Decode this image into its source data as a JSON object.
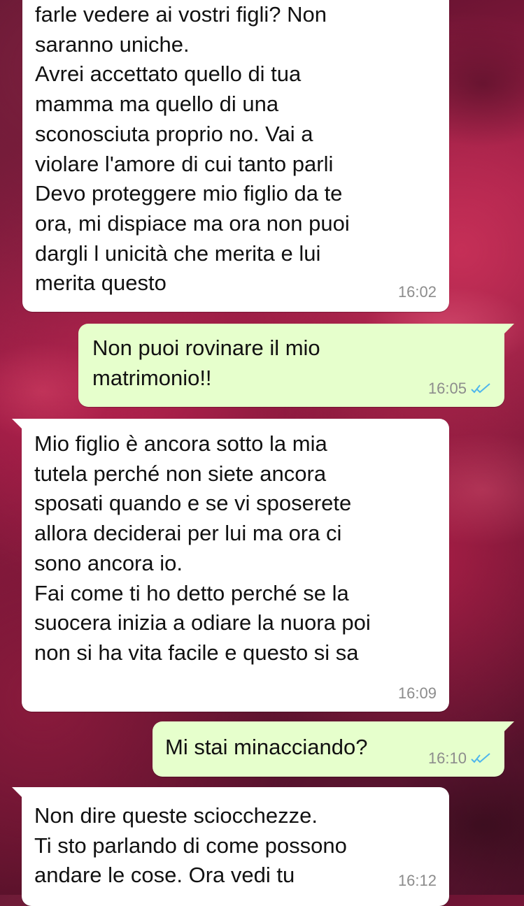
{
  "chat": {
    "messages": [
      {
        "direction": "in",
        "text": "farle vedere ai vostri figli? Non\nsaranno uniche.\nAvrei accettato quello di tua\nmamma ma quello di una\nsconosciuta proprio no. Vai a\nviolare l'amore di cui tanto parli\nDevo proteggere mio figlio da te\nora, mi dispiace ma ora non puoi\ndargli l unicità che merita e lui\nmerita questo",
        "time": "16:02"
      },
      {
        "direction": "out",
        "text": "Non puoi rovinare il mio\nmatrimonio!!",
        "time": "16:05",
        "status_icon": "double-check-read-icon"
      },
      {
        "direction": "in",
        "text": "Mio figlio è ancora sotto la mia\ntutela perché non siete ancora\nsposati quando e se vi sposerete\nallora deciderai per lui ma ora ci\nsono ancora io.\nFai come ti ho detto perché se la\nsuocera inizia a odiare la nuora poi\nnon si ha vita facile e questo si sa",
        "time": "16:09"
      },
      {
        "direction": "out",
        "text": "Mi stai minacciando?",
        "time": "16:10",
        "status_icon": "double-check-read-icon"
      },
      {
        "direction": "in",
        "text": "Non dire queste sciocchezze.\nTi sto parlando di come possono\nandare le cose. Ora vedi tu",
        "time": "16:12"
      }
    ]
  },
  "colors": {
    "incoming_bubble": "#ffffff",
    "outgoing_bubble": "#e6ffcc",
    "read_ticks": "#4fb6ec",
    "timestamp": "#8c8c8c"
  }
}
